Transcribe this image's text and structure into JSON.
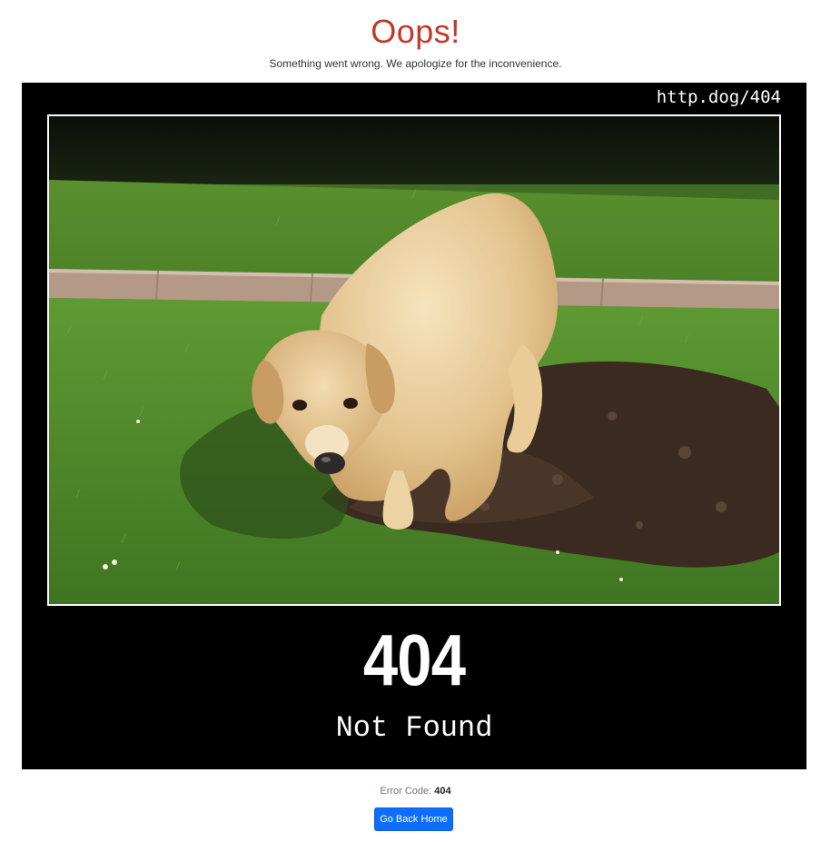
{
  "header": {
    "title": "Oops!",
    "subtitle": "Something went wrong. We apologize for the inconvenience."
  },
  "dog_card": {
    "url_label": "http.dog/404",
    "status_code": "404",
    "status_text": "Not Found",
    "photo_alt": "Golden retriever digging a hole in a lawn"
  },
  "footer": {
    "error_code_label": "Error Code:",
    "error_code_value": "404",
    "home_button_label": "Go Back Home"
  },
  "colors": {
    "title": "#c0392b",
    "button": "#0d6efd",
    "card_background": "#000000"
  }
}
